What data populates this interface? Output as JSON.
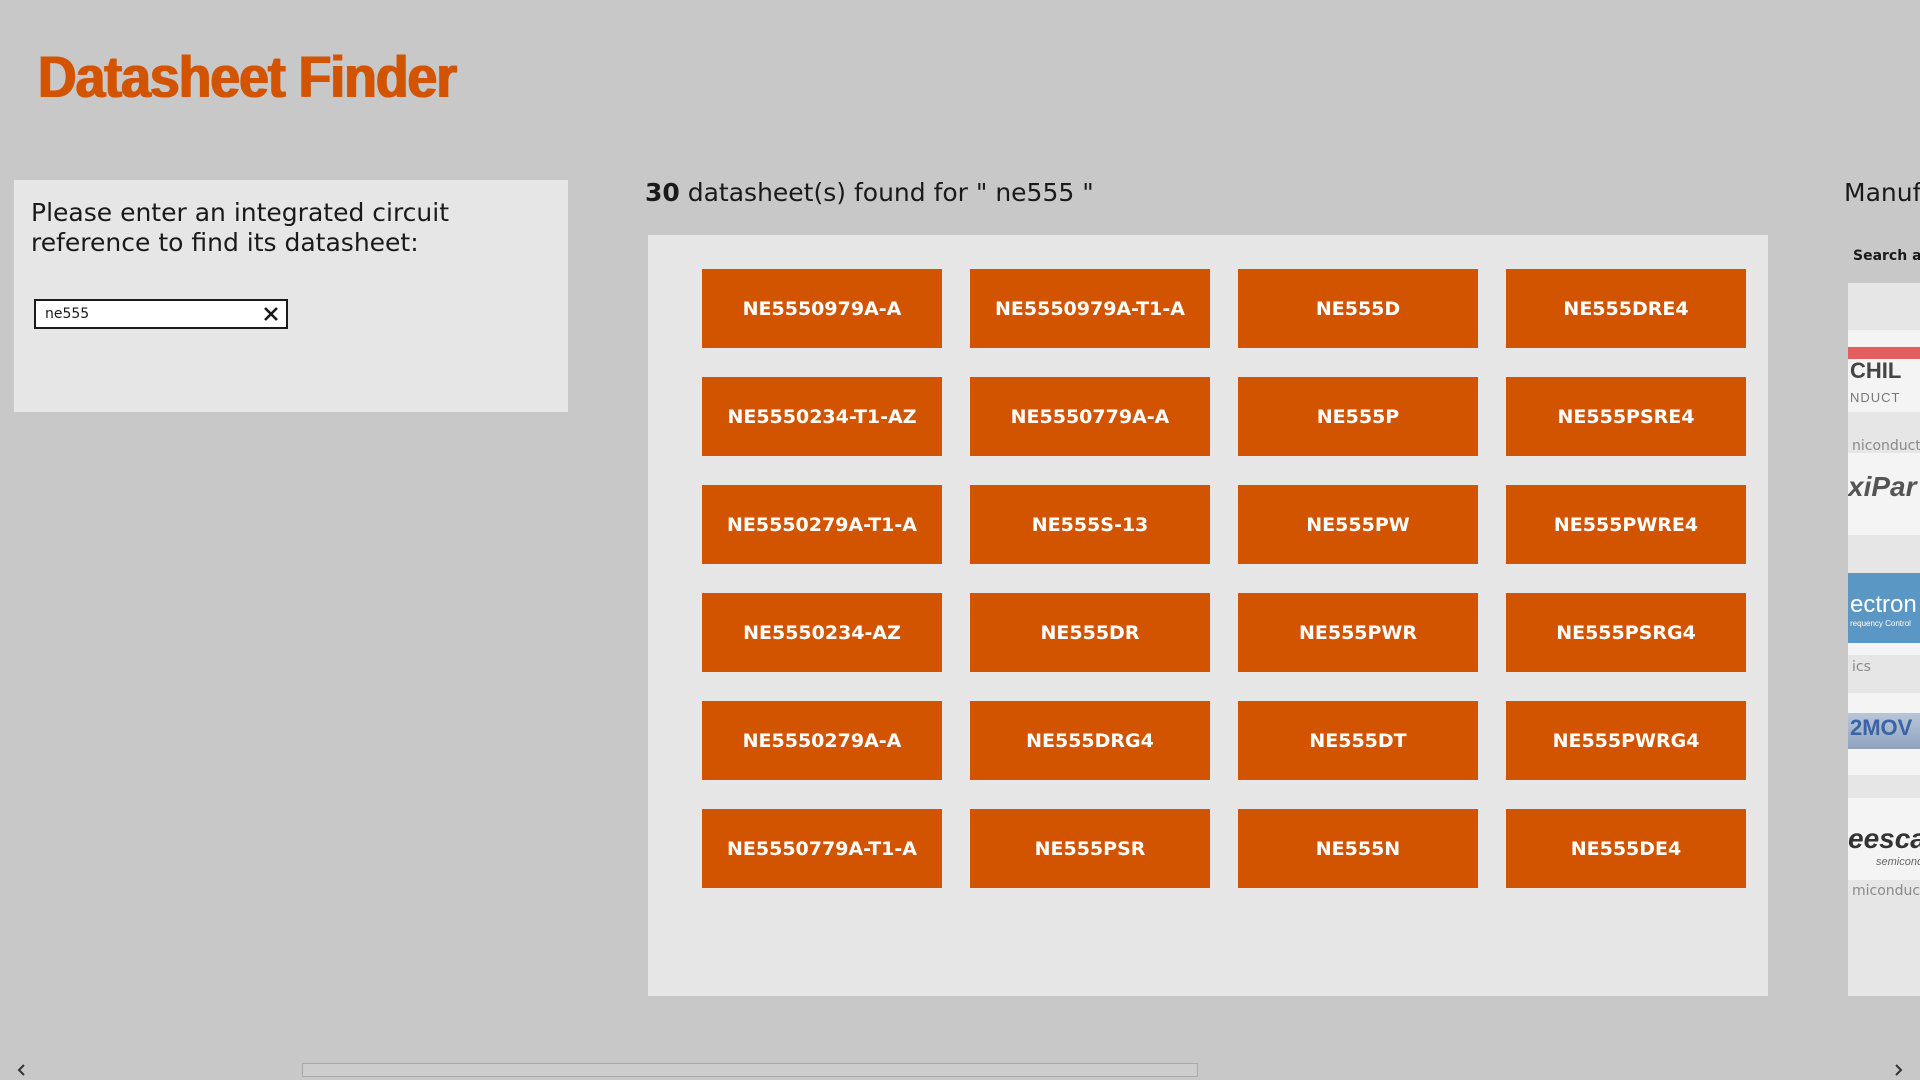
{
  "app": {
    "title": "Datasheet Finder"
  },
  "search": {
    "prompt": "Please enter an integrated circuit reference to find its datasheet:",
    "value": "ne555"
  },
  "results": {
    "count": "30",
    "summary": " datasheet(s) found for \" ne555 \"",
    "items": [
      "NE5550979A-A",
      "NE5550979A-T1-A",
      "NE555D",
      "NE555DRE4",
      "NE5550234-T1-AZ",
      "NE5550779A-A",
      "NE555P",
      "NE555PSRE4",
      "NE5550279A-T1-A",
      "NE555S-13",
      "NE555PW",
      "NE555PWRE4",
      "NE5550234-AZ",
      "NE555DR",
      "NE555PWR",
      "NE555PSRG4",
      "NE5550279A-A",
      "NE555DRG4",
      "NE555DT",
      "NE555PWRG4",
      "NE5550779A-T1-A",
      "NE555PSR",
      "NE555N",
      "NE555DE4"
    ]
  },
  "manufacturers": {
    "heading": "Manuf",
    "search_label": "Search am",
    "logos": [
      {
        "icon": "fairchild-logo",
        "text": "CHIL",
        "subtext": "NDUCT",
        "caption": "niconduct"
      },
      {
        "icon": "maxipar-logo",
        "text": "xiPar",
        "caption": ""
      },
      {
        "icon": "electronics-logo",
        "text": "ectron",
        "subtext": "requency Control",
        "caption": "ics"
      },
      {
        "icon": "2move-logo",
        "text": "2MOV",
        "caption": ""
      },
      {
        "icon": "freescale-logo",
        "text": "eesca",
        "subtext": "semicond",
        "caption": "miconduc"
      }
    ]
  },
  "colors": {
    "accent": "#d35400",
    "background": "#c8c8c8",
    "panel": "#e6e6e6"
  }
}
